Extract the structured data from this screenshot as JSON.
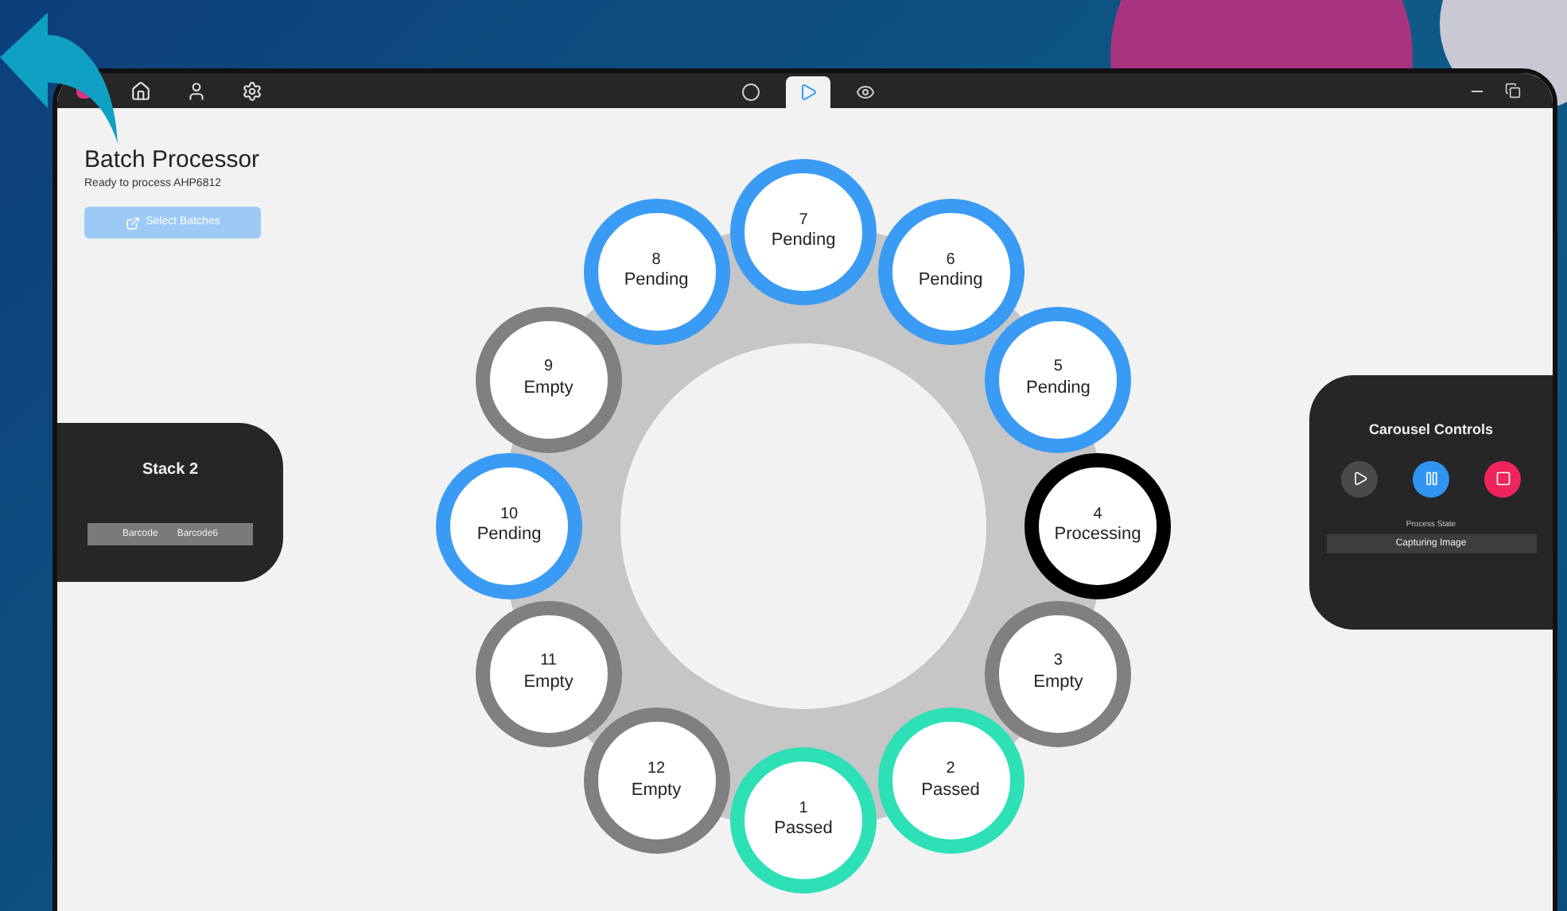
{
  "toolbar": {
    "left_icons": [
      {
        "kind": "home"
      },
      {
        "kind": "user"
      },
      {
        "kind": "settings"
      }
    ],
    "tabs": [
      {
        "kind": "record",
        "selected": false
      },
      {
        "kind": "play",
        "selected": true
      },
      {
        "kind": "view",
        "selected": false
      }
    ]
  },
  "header": {
    "title": "Batch Processor",
    "subtitle": "Ready to process AHP6812",
    "button": {
      "label": "Select Batches",
      "disabled": true
    }
  },
  "stack_panel": {
    "title": "Stack 2",
    "barcode_label": "Barcode",
    "barcode_value": "Barcode6"
  },
  "carousel": {
    "rows": [
      [
        {
          "number": "7",
          "status": "Pending",
          "kind": "pending"
        }
      ],
      [
        {
          "number": "8",
          "status": "Pending",
          "kind": "pending"
        },
        {
          "number": "6",
          "status": "Pending",
          "kind": "pending"
        }
      ],
      [
        {
          "number": "9",
          "status": "Empty",
          "kind": "empty"
        },
        {
          "number": "5",
          "status": "Pending",
          "kind": "pending"
        }
      ],
      [
        {
          "number": "10",
          "status": "Pending",
          "kind": "pending"
        },
        {
          "number": "4",
          "status": "Processing",
          "kind": "processing"
        }
      ],
      [
        {
          "number": "11",
          "status": "Empty",
          "kind": "empty"
        },
        {
          "number": "3",
          "status": "Empty",
          "kind": "empty"
        }
      ],
      [
        {
          "number": "12",
          "status": "Empty",
          "kind": "empty"
        },
        {
          "number": "2",
          "status": "Passed",
          "kind": "passed"
        }
      ],
      [
        {
          "number": "1",
          "status": "Passed",
          "kind": "passed"
        }
      ]
    ]
  },
  "controls_panel": {
    "title": "Carousel Controls",
    "buttons": [
      {
        "kind": "play",
        "disabled": true
      },
      {
        "kind": "pause",
        "disabled": false
      },
      {
        "kind": "stop",
        "disabled": false
      }
    ],
    "state_label": "Process State",
    "state_value": "Capturing Image"
  }
}
